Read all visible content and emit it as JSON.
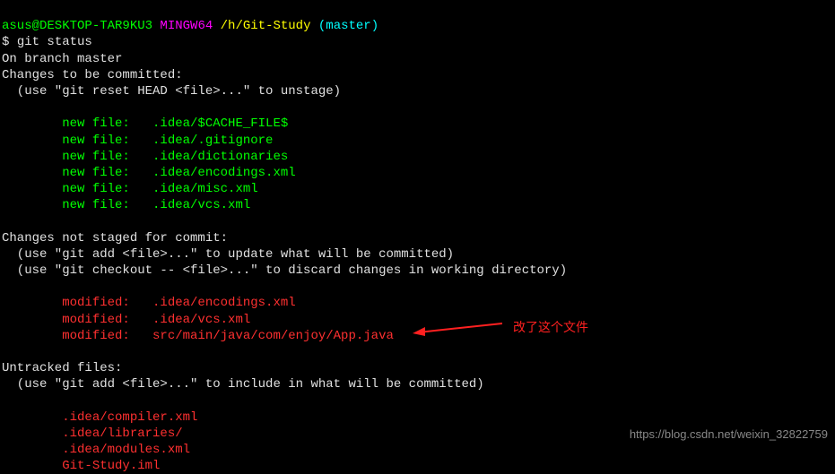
{
  "prompt": {
    "user": "asus@DESKTOP-TAR9KU3",
    "shell": " MINGW64 ",
    "path": "/h/Git-Study",
    "branch": " (master)"
  },
  "command": {
    "symbol": "$ ",
    "text": "git status"
  },
  "output": {
    "on_branch": "On branch master",
    "changes_staged_header": "Changes to be committed:",
    "unstage_hint": "  (use \"git reset HEAD <file>...\" to unstage)",
    "new_files": [
      "        new file:   .idea/$CACHE_FILE$",
      "        new file:   .idea/.gitignore",
      "        new file:   .idea/dictionaries",
      "        new file:   .idea/encodings.xml",
      "        new file:   .idea/misc.xml",
      "        new file:   .idea/vcs.xml"
    ],
    "changes_not_staged_header": "Changes not staged for commit:",
    "add_hint": "  (use \"git add <file>...\" to update what will be committed)",
    "checkout_hint": "  (use \"git checkout -- <file>...\" to discard changes in working directory)",
    "modified_files": [
      "        modified:   .idea/encodings.xml",
      "        modified:   .idea/vcs.xml",
      "        modified:   src/main/java/com/enjoy/App.java"
    ],
    "untracked_header": "Untracked files:",
    "untracked_hint": "  (use \"git add <file>...\" to include in what will be committed)",
    "untracked_files": [
      "        .idea/compiler.xml",
      "        .idea/libraries/",
      "        .idea/modules.xml",
      "        Git-Study.iml"
    ]
  },
  "annotation": {
    "text": "改了这个文件"
  },
  "watermark": "https://blog.csdn.net/weixin_32822759"
}
